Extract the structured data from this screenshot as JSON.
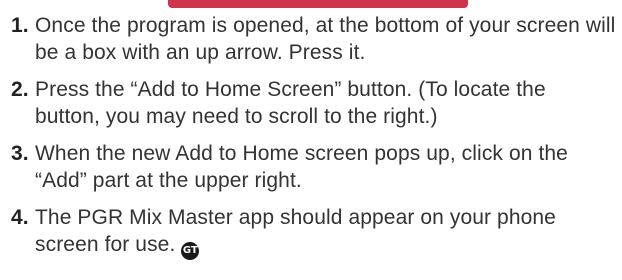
{
  "steps": [
    {
      "number": "1.",
      "text": "Once the program is opened, at the bottom of your screen will be a box with an up arrow. Press it."
    },
    {
      "number": "2.",
      "text": "Press the “Add to Home Screen” button. (To locate the button, you may need to scroll to the right.)"
    },
    {
      "number": "3.",
      "text": "When the new Add to Home screen pops up, click on the “Add” part at the upper right."
    },
    {
      "number": "4.",
      "text": "The PGR Mix Master app should appear on your phone screen for use."
    }
  ],
  "end_mark": {
    "icon": "end-of-article-icon",
    "glyph": "GT"
  },
  "colors": {
    "accent": "#c8102e",
    "text": "#333333"
  }
}
